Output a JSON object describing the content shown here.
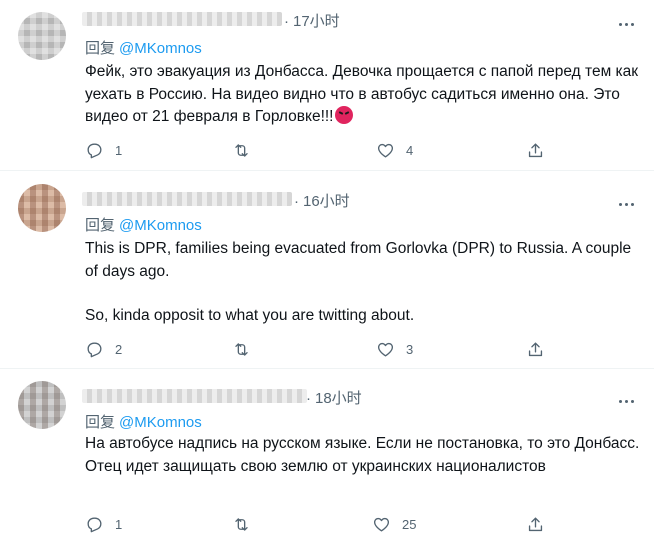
{
  "reply_prefix": "回复",
  "tweets": [
    {
      "time": "17小时",
      "reply_to": "@MKomnos",
      "lines": [
        "Фейк, это эвакуация из Донбасса. Девочка прощается с папой перед тем как уехать в Россию. На видео видно что в автобус садиться именно она. Это видео от 21 февраля в Горловке!!!"
      ],
      "emoji": "angry-face-emoji",
      "reply_count": "1",
      "retweet_count": "",
      "like_count": "4"
    },
    {
      "time": "16小时",
      "reply_to": "@MKomnos",
      "lines": [
        "This is DPR, families being evacuated from Gorlovka (DPR) to Russia. A couple of days ago.",
        "So, kinda opposit to what you are twitting about."
      ],
      "reply_count": "2",
      "retweet_count": "",
      "like_count": "3"
    },
    {
      "time": "18小时",
      "reply_to": "@MKomnos",
      "lines": [
        "На автобусе надпись на русском языке. Если не постановка, то это Донбасс. Отец идет защищать свою землю от украинских националистов"
      ],
      "reply_count": "1",
      "retweet_count": "",
      "like_count": "25"
    }
  ],
  "icons": {
    "reply": "reply-icon",
    "retweet": "retweet-icon",
    "like": "like-icon",
    "share": "share-icon",
    "more": "more-icon"
  }
}
